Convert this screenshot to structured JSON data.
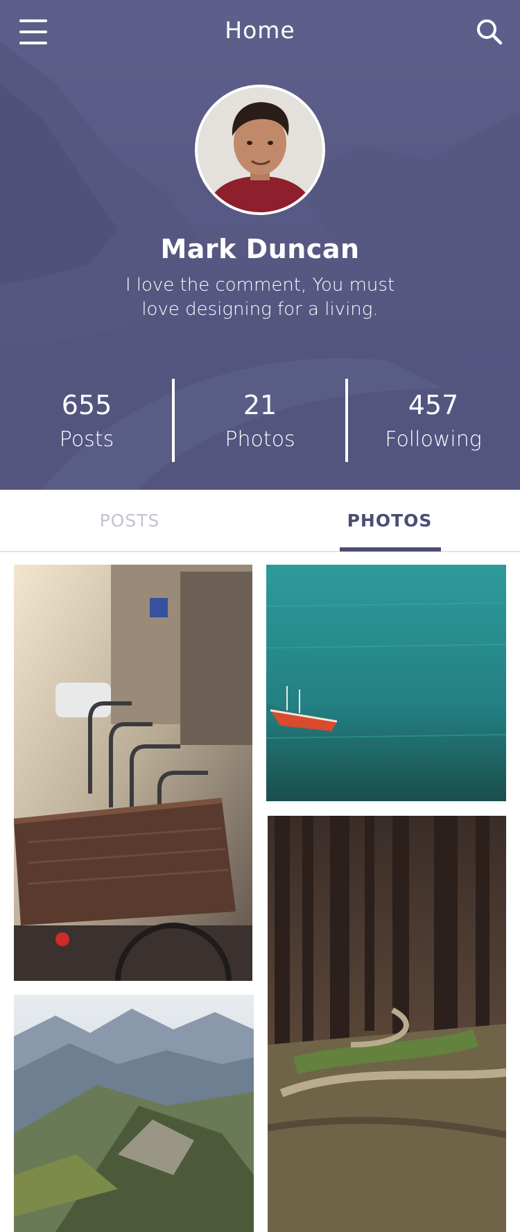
{
  "header": {
    "title": "Home",
    "menu_icon": "hamburger-menu-icon",
    "search_icon": "search-icon"
  },
  "profile": {
    "name": "Mark Duncan",
    "bio": "I love the comment, You must love designing for a living."
  },
  "stats": [
    {
      "value": "655",
      "label": "Posts"
    },
    {
      "value": "21",
      "label": "Photos"
    },
    {
      "value": "457",
      "label": "Following"
    }
  ],
  "tabs": [
    {
      "label": "POSTS",
      "active": false
    },
    {
      "label": "PHOTOS",
      "active": true
    }
  ],
  "photos": [
    {
      "subject": "street bicycles with basket"
    },
    {
      "subject": "red boat on turquoise water"
    },
    {
      "subject": "mountain ridge landscape"
    },
    {
      "subject": "forest path through trees"
    }
  ],
  "colors": {
    "hero_tint": "#525480",
    "accent": "#4b4d72",
    "inactive_tab": "#c2c3cf"
  }
}
